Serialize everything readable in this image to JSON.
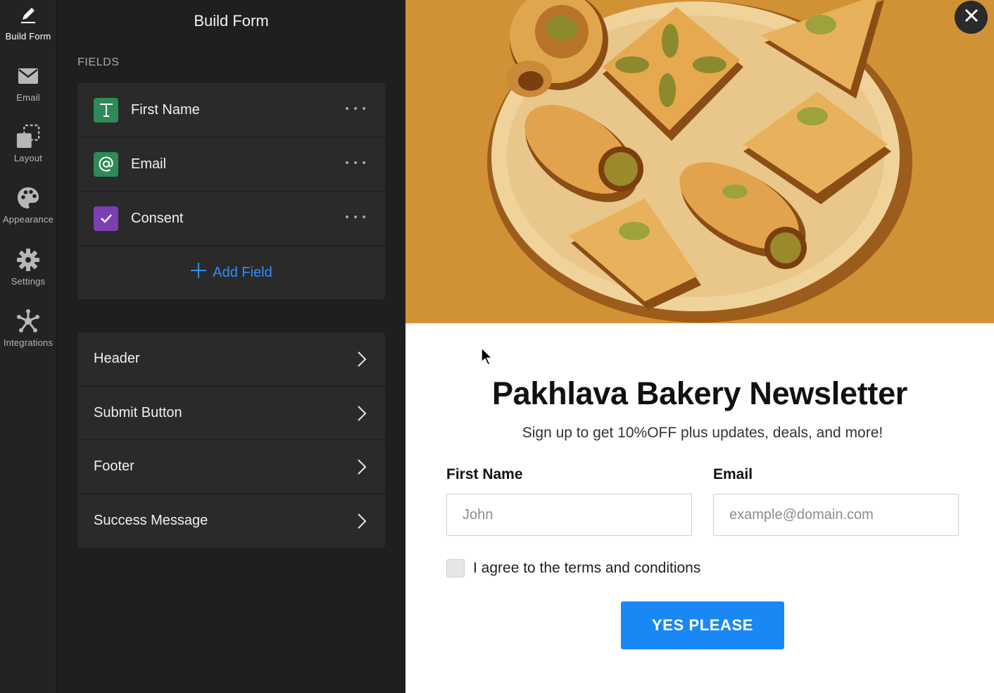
{
  "nav": {
    "items": [
      {
        "label": "Build Form",
        "icon": "pencil-icon"
      },
      {
        "label": "Email",
        "icon": "envelope-icon"
      },
      {
        "label": "Layout",
        "icon": "layout-icon"
      },
      {
        "label": "Appearance",
        "icon": "palette-icon"
      },
      {
        "label": "Settings",
        "icon": "gear-icon"
      },
      {
        "label": "Integrations",
        "icon": "integrations-icon"
      }
    ]
  },
  "builder": {
    "title": "Build Form",
    "fields_heading": "FIELDS",
    "fields": [
      {
        "label": "First Name",
        "icon": "text-icon",
        "color": "#2e8b57"
      },
      {
        "label": "Email",
        "icon": "at-icon",
        "color": "#2e8b57"
      },
      {
        "label": "Consent",
        "icon": "checkbox-icon",
        "color": "#7b3fb0"
      }
    ],
    "add_field": "Add Field",
    "sections": [
      "Header",
      "Submit Button",
      "Footer",
      "Success Message"
    ]
  },
  "preview": {
    "title": "Pakhlava Bakery Newsletter",
    "subtitle": "Sign up to get 10%OFF plus updates, deals, and more!",
    "first_name_label": "First Name",
    "first_name_placeholder": "John",
    "email_label": "Email",
    "email_placeholder": "example@domain.com",
    "consent_text": "I agree to the terms and conditions",
    "submit_label": "YES PLEASE"
  },
  "colors": {
    "accent": "#1a88f4",
    "add_field": "#2f8fff",
    "hero_bg": "#d19235"
  }
}
